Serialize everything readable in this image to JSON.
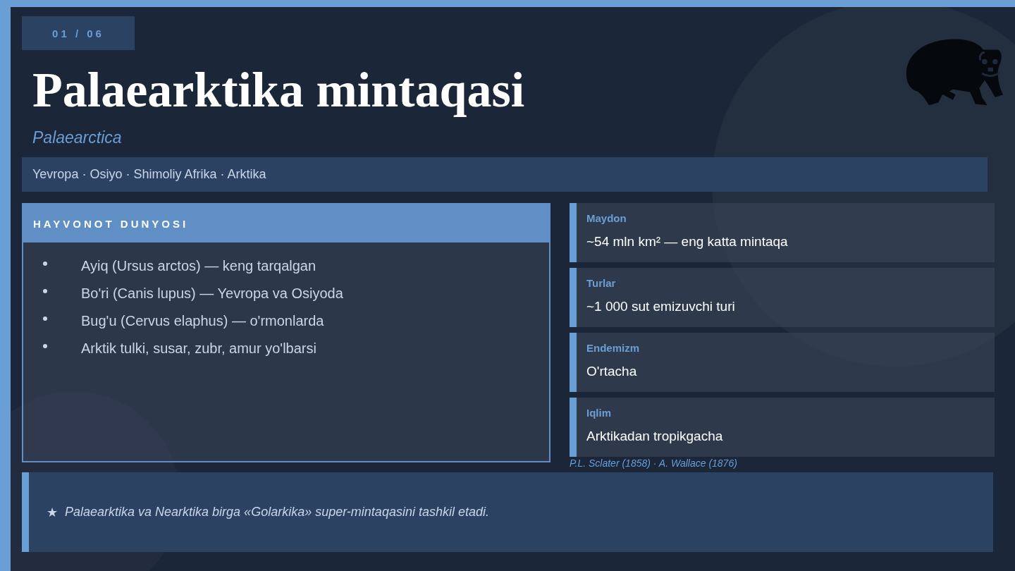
{
  "counter": "01 / 06",
  "title": "Palaearktika mintaqasi",
  "subtitle": "Palaearctica",
  "regions": "Yevropa · Osiyo · Shimoliy Afrika · Arktika",
  "fauna": {
    "heading": "HAYVONOT DUNYOSI",
    "items": [
      "Ayiq (Ursus arctos) — keng tarqalgan",
      "Bo'ri (Canis lupus) — Yevropa va Osiyoda",
      "Bug'u (Cervus elaphus) — o'rmonlarda",
      "Arktik tulki, susar, zubr, amur yo'lbarsi"
    ]
  },
  "facts": [
    {
      "label": "Maydon",
      "value": "~54 mln km² — eng katta mintaqa"
    },
    {
      "label": "Turlar",
      "value": "~1 000 sut emizuvchi turi"
    },
    {
      "label": "Endemizm",
      "value": "O'rtacha"
    },
    {
      "label": "Iqlim",
      "value": "Arktikadan tropikgacha"
    }
  ],
  "source": "P.L. Sclater (1858) · A. Wallace (1876)",
  "note": {
    "icon": "★",
    "text": "Palaearktika va Nearktika birga «Golarkika» super-mintaqasini tashkil etadi."
  }
}
